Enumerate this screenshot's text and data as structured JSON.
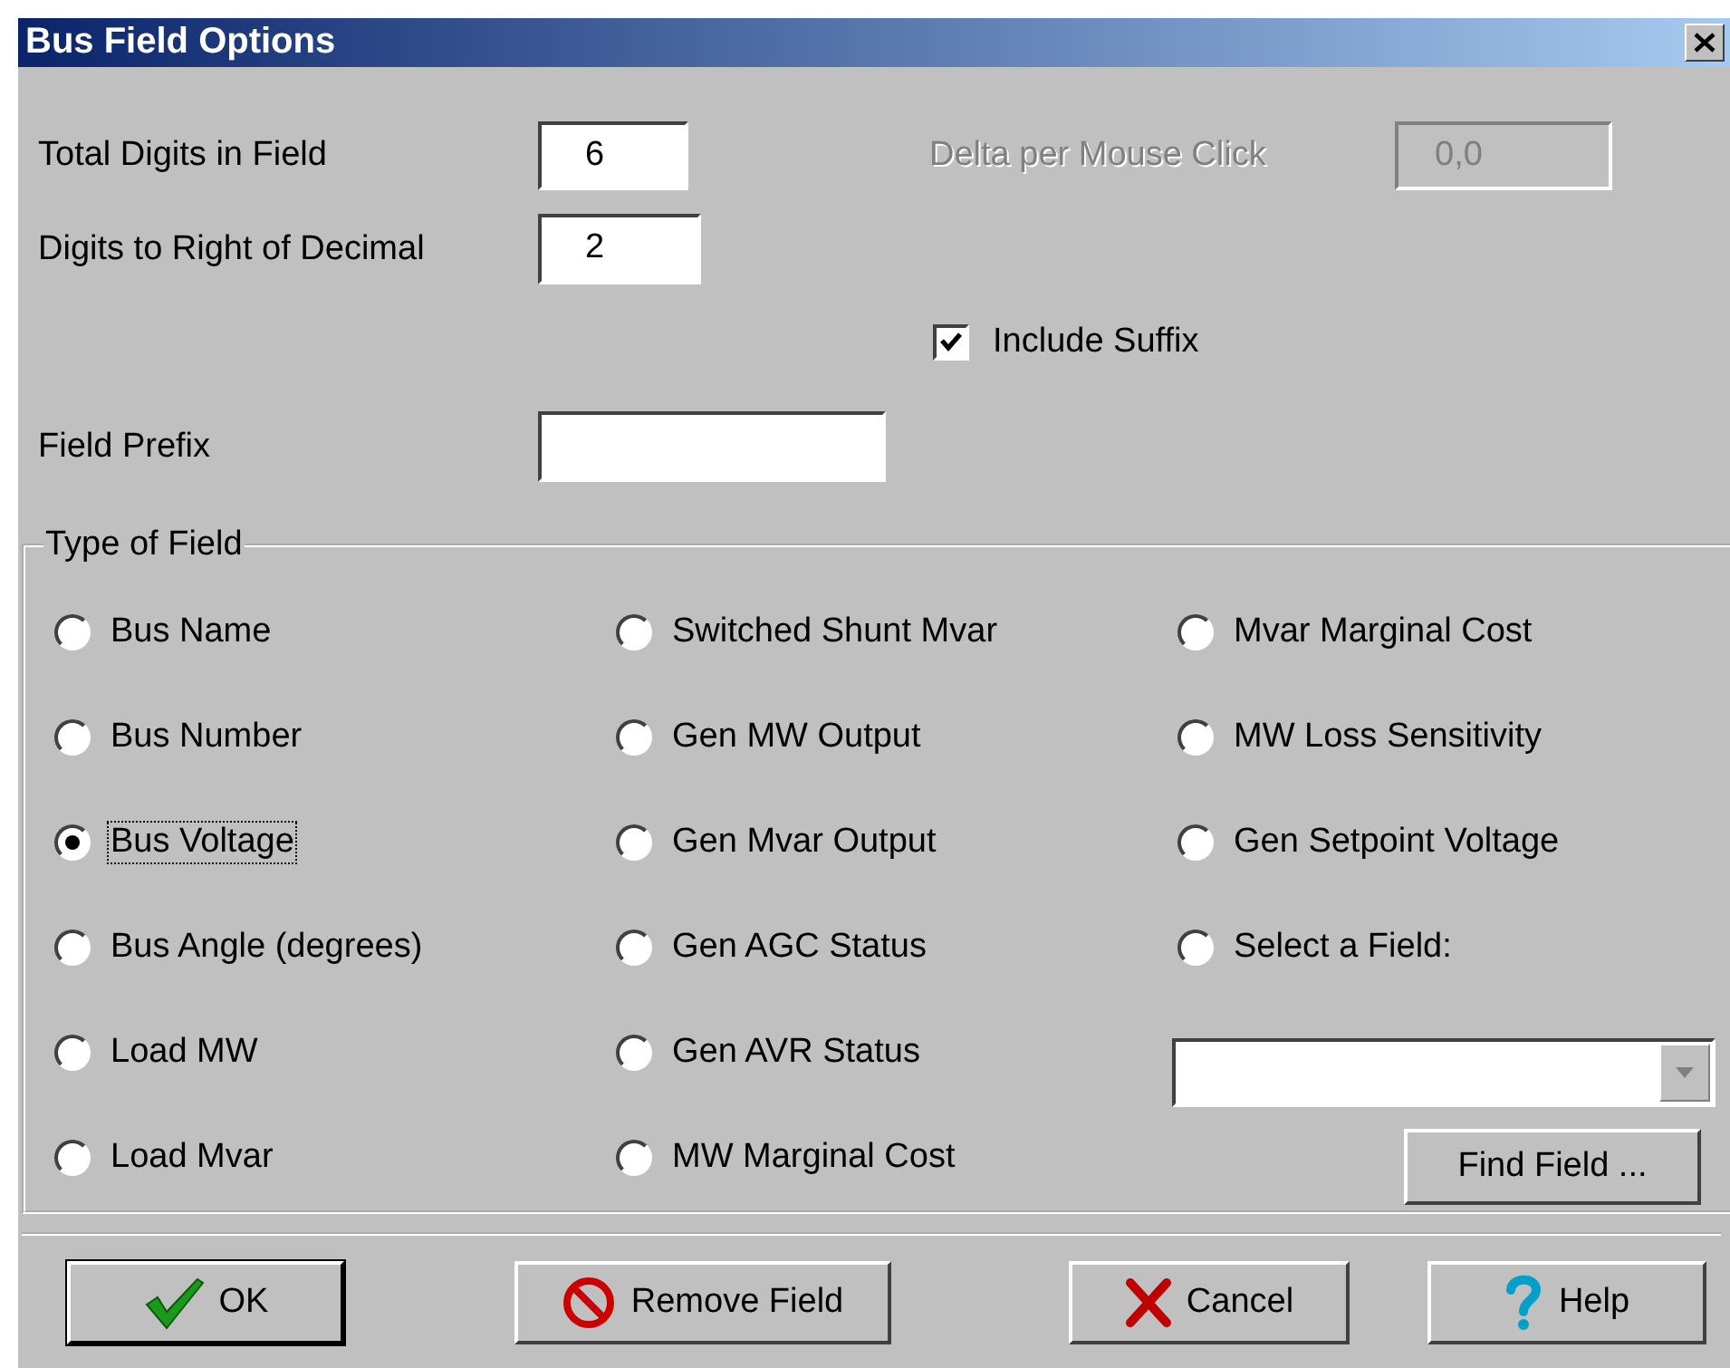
{
  "window": {
    "title": "Bus Field Options"
  },
  "fields": [
    {
      "label": "Total Digits in Field",
      "value": "6",
      "disabled": false
    },
    {
      "label": "Delta per Mouse Click",
      "value": "0,0",
      "disabled": true
    },
    {
      "label": "Digits to Right of Decimal",
      "value": "2",
      "disabled": false
    },
    {
      "label": "Field Prefix",
      "disabled": false
    }
  ],
  "include_suffix": {
    "label": "Include Suffix",
    "checked": true
  },
  "type_of_field": {
    "title": "Type of Field",
    "columns": [
      [
        {
          "label": "Bus Name",
          "selected": false,
          "focused": false
        },
        {
          "label": "Bus Number",
          "selected": false,
          "focused": false
        },
        {
          "label": "Bus Voltage",
          "selected": true,
          "focused": true
        },
        {
          "label": "Bus Angle (degrees)",
          "selected": false,
          "focused": false
        },
        {
          "label": "Load MW",
          "selected": false,
          "focused": false
        },
        {
          "label": "Load Mvar",
          "selected": false,
          "focused": false
        }
      ],
      [
        {
          "label": "Switched Shunt Mvar",
          "selected": false,
          "focused": false
        },
        {
          "label": "Gen MW Output",
          "selected": false,
          "focused": false
        },
        {
          "label": "Gen Mvar Output",
          "selected": false,
          "focused": false
        },
        {
          "label": "Gen AGC Status",
          "selected": false,
          "focused": false
        },
        {
          "label": "Gen AVR Status",
          "selected": false,
          "focused": false
        },
        {
          "label": "MW Marginal Cost",
          "selected": false,
          "focused": false
        }
      ],
      [
        {
          "label": "Mvar Marginal Cost",
          "selected": false,
          "focused": false
        },
        {
          "label": "MW Loss Sensitivity",
          "selected": false,
          "focused": false
        },
        {
          "label": "Gen Setpoint Voltage",
          "selected": false,
          "focused": false
        },
        {
          "label": "Select a Field:",
          "selected": false,
          "focused": false
        }
      ]
    ],
    "find_button": "Find Field ..."
  },
  "buttons": [
    {
      "kind": "ok",
      "label": "OK"
    },
    {
      "kind": "remove",
      "label": "Remove Field"
    },
    {
      "kind": "cancel",
      "label": "Cancel"
    },
    {
      "kind": "help",
      "label": "Help"
    }
  ]
}
